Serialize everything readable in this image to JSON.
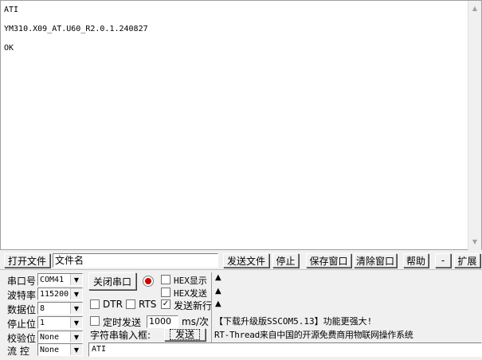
{
  "terminal": {
    "lines": [
      "ATI",
      "",
      "YM310.X09_AT.U60_R2.0.1.240827",
      "",
      "OK"
    ]
  },
  "toolbar": {
    "open_file": "打开文件",
    "filename": "文件名",
    "send_file": "发送文件",
    "stop": "停止",
    "save_window": "保存窗口",
    "clear_window": "清除窗口",
    "help": "帮助",
    "minus": "-",
    "expand": "扩展"
  },
  "settings": {
    "port_label": "串口号",
    "port_value": "COM41",
    "baud_label": "波特率",
    "baud_value": "115200",
    "databits_label": "数据位",
    "databits_value": "8",
    "stopbits_label": "停止位",
    "stopbits_value": "1",
    "parity_label": "校验位",
    "parity_value": "None",
    "flow_label": "流 控",
    "flow_value": "None"
  },
  "controls": {
    "close_port": "关闭串口",
    "hex_display": "HEX显示",
    "hex_send": "HEX发送",
    "dtr": "DTR",
    "rts": "RTS",
    "newline": "发送新行",
    "timed_send": "定时发送",
    "interval_value": "1000",
    "interval_unit": "ms/次",
    "string_input_label": "字符串输入框:",
    "send": "发送",
    "tri_symbol": "▲",
    "check_mark": "✓"
  },
  "ad": {
    "line1": "【下载升级版SSCOM5.13】功能更强大!",
    "line2": "RT-Thread来自中国的开源免费商用物联网操作系统"
  },
  "input": {
    "value": "ATI"
  },
  "colors": {
    "indicator": "#d00000",
    "window_bg": "#f0f0f0"
  }
}
